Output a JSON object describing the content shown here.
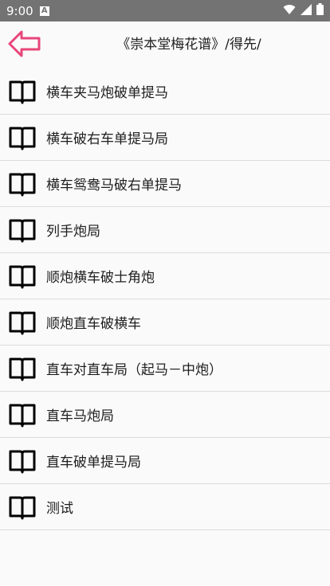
{
  "status_bar": {
    "time": "9:00",
    "notification_icon": "a-icon",
    "right_icons": [
      "wifi-icon",
      "signal-icon",
      "battery-icon"
    ]
  },
  "header": {
    "back_icon": "back-arrow-icon",
    "title": "《崇本堂梅花谱》/得先/",
    "accent_color": "#e8457a"
  },
  "list": {
    "items": [
      {
        "label": "横车夹马炮破单提马",
        "icon": "book-icon"
      },
      {
        "label": "横车破右车单提马局",
        "icon": "book-icon"
      },
      {
        "label": "横车鸳鸯马破右单提马",
        "icon": "book-icon"
      },
      {
        "label": "列手炮局",
        "icon": "book-icon"
      },
      {
        "label": "顺炮横车破士角炮",
        "icon": "book-icon"
      },
      {
        "label": "顺炮直车破横车",
        "icon": "book-icon"
      },
      {
        "label": "直车对直车局（起马－中炮）",
        "icon": "book-icon"
      },
      {
        "label": "直车马炮局",
        "icon": "book-icon"
      },
      {
        "label": "直车破单提马局",
        "icon": "book-icon"
      },
      {
        "label": "测试",
        "icon": "book-icon"
      }
    ]
  }
}
